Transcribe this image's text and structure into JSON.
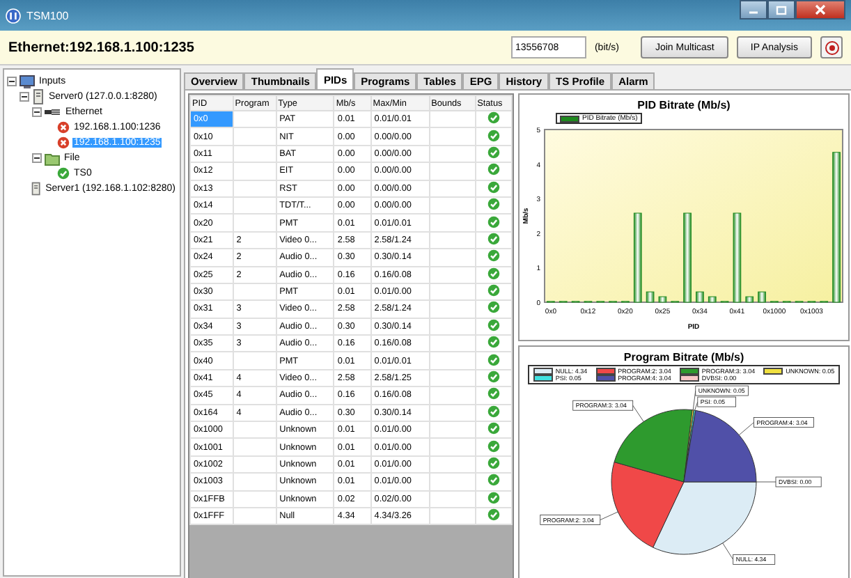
{
  "window": {
    "title": "TSM100"
  },
  "header": {
    "source": "Ethernet:192.168.1.100:1235",
    "bitrate_value": "13556708",
    "bitrate_unit": "(bit/s)",
    "buttons": [
      "Join Multicast",
      "IP Analysis"
    ]
  },
  "tree": [
    {
      "label": "Inputs",
      "kind": "root",
      "expanded": true,
      "selected": false,
      "children": [
        {
          "label": "Server0 (127.0.0.1:8280)",
          "kind": "server",
          "expanded": true,
          "selected": false,
          "children": [
            {
              "label": "Ethernet",
              "kind": "network",
              "expanded": true,
              "selected": false,
              "children": [
                {
                  "label": "192.168.1.100:1236",
                  "kind": "error",
                  "selected": false
                },
                {
                  "label": "192.168.1.100:1235",
                  "kind": "error",
                  "selected": true
                }
              ]
            },
            {
              "label": "File",
              "kind": "file",
              "expanded": true,
              "selected": false,
              "children": [
                {
                  "label": "TS0",
                  "kind": "ok",
                  "selected": false
                }
              ]
            }
          ]
        },
        {
          "label": "Server1 (192.168.1.102:8280)",
          "kind": "server",
          "selected": false
        }
      ]
    }
  ],
  "tabs": [
    {
      "label": "Overview",
      "selected": false
    },
    {
      "label": "Thumbnails",
      "selected": false
    },
    {
      "label": "PIDs",
      "selected": true
    },
    {
      "label": "Programs",
      "selected": false
    },
    {
      "label": "Tables",
      "selected": false
    },
    {
      "label": "EPG",
      "selected": false
    },
    {
      "label": "History",
      "selected": false
    },
    {
      "label": "TS Profile",
      "selected": false
    },
    {
      "label": "Alarm",
      "selected": false
    }
  ],
  "table": {
    "columns": [
      "PID",
      "Program",
      "Type",
      "Mb/s",
      "Max/Min",
      "Bounds",
      "Status"
    ],
    "rows": [
      {
        "pid": "0x0",
        "type": "PAT",
        "rate": "0.01",
        "maxmin": "0.01/0.01",
        "ok": true,
        "selected": true
      },
      {
        "pid": "0x10",
        "type": "NIT",
        "rate": "0.00",
        "maxmin": "0.00/0.00",
        "ok": true,
        "selected": false
      },
      {
        "pid": "0x11",
        "type": "BAT",
        "rate": "0.00",
        "maxmin": "0.00/0.00",
        "ok": true,
        "selected": false
      },
      {
        "pid": "0x12",
        "type": "EIT",
        "rate": "0.00",
        "maxmin": "0.00/0.00",
        "ok": true,
        "selected": false
      },
      {
        "pid": "0x13",
        "type": "RST",
        "rate": "0.00",
        "maxmin": "0.00/0.00",
        "ok": true,
        "selected": false
      },
      {
        "pid": "0x14",
        "type": "TDT/T...",
        "rate": "0.00",
        "maxmin": "0.00/0.00",
        "ok": true,
        "selected": false
      },
      {
        "pid": "0x20",
        "type": "PMT",
        "rate": "0.01",
        "maxmin": "0.01/0.01",
        "ok": true,
        "selected": false
      },
      {
        "pid": "0x21",
        "program": "2",
        "type": "Video 0...",
        "rate": "2.58",
        "maxmin": "2.58/1.24",
        "ok": true,
        "selected": false
      },
      {
        "pid": "0x24",
        "program": "2",
        "type": "Audio 0...",
        "rate": "0.30",
        "maxmin": "0.30/0.14",
        "ok": true,
        "selected": false
      },
      {
        "pid": "0x25",
        "program": "2",
        "type": "Audio 0...",
        "rate": "0.16",
        "maxmin": "0.16/0.08",
        "ok": true,
        "selected": false
      },
      {
        "pid": "0x30",
        "type": "PMT",
        "rate": "0.01",
        "maxmin": "0.01/0.00",
        "ok": true,
        "selected": false
      },
      {
        "pid": "0x31",
        "program": "3",
        "type": "Video 0...",
        "rate": "2.58",
        "maxmin": "2.58/1.24",
        "ok": true,
        "selected": false
      },
      {
        "pid": "0x34",
        "program": "3",
        "type": "Audio 0...",
        "rate": "0.30",
        "maxmin": "0.30/0.14",
        "ok": true,
        "selected": false
      },
      {
        "pid": "0x35",
        "program": "3",
        "type": "Audio 0...",
        "rate": "0.16",
        "maxmin": "0.16/0.08",
        "ok": true,
        "selected": false
      },
      {
        "pid": "0x40",
        "type": "PMT",
        "rate": "0.01",
        "maxmin": "0.01/0.01",
        "ok": true,
        "selected": false
      },
      {
        "pid": "0x41",
        "program": "4",
        "type": "Video 0...",
        "rate": "2.58",
        "maxmin": "2.58/1.25",
        "ok": true,
        "selected": false
      },
      {
        "pid": "0x45",
        "program": "4",
        "type": "Audio 0...",
        "rate": "0.16",
        "maxmin": "0.16/0.08",
        "ok": true,
        "selected": false
      },
      {
        "pid": "0x164",
        "program": "4",
        "type": "Audio 0...",
        "rate": "0.30",
        "maxmin": "0.30/0.14",
        "ok": true,
        "selected": false
      },
      {
        "pid": "0x1000",
        "type": "Unknown",
        "rate": "0.01",
        "maxmin": "0.01/0.00",
        "ok": true,
        "selected": false
      },
      {
        "pid": "0x1001",
        "type": "Unknown",
        "rate": "0.01",
        "maxmin": "0.01/0.00",
        "ok": true,
        "selected": false
      },
      {
        "pid": "0x1002",
        "type": "Unknown",
        "rate": "0.01",
        "maxmin": "0.01/0.00",
        "ok": true,
        "selected": false
      },
      {
        "pid": "0x1003",
        "type": "Unknown",
        "rate": "0.01",
        "maxmin": "0.01/0.00",
        "ok": true,
        "selected": false
      },
      {
        "pid": "0x1FFB",
        "type": "Unknown",
        "rate": "0.02",
        "maxmin": "0.02/0.00",
        "ok": true,
        "selected": false
      },
      {
        "pid": "0x1FFF",
        "type": "Null",
        "rate": "4.34",
        "maxmin": "4.34/3.26",
        "ok": true,
        "selected": false
      }
    ]
  },
  "bar_panel": {
    "chart_data": {
      "type": "bar",
      "title": "PID Bitrate (Mb/s)",
      "xlabel": "PID",
      "ylabel": "Mb/s",
      "categories": [
        "0x0",
        null,
        null,
        "0x12",
        null,
        null,
        "0x20",
        null,
        null,
        "0x25",
        null,
        null,
        "0x34",
        null,
        null,
        "0x41",
        null,
        null,
        "0x1000",
        null,
        null,
        "0x1003",
        null,
        null
      ],
      "series": [
        {
          "name": "PID Bitrate (Mb/s)",
          "color": "#1e8a1e",
          "values": [
            0.01,
            0,
            0,
            0,
            0,
            0,
            0.01,
            2.58,
            0.3,
            0.16,
            0.01,
            2.58,
            0.3,
            0.16,
            0.01,
            2.58,
            0.16,
            0.3,
            0.01,
            0.01,
            0.01,
            0.01,
            0.02,
            4.34
          ]
        }
      ],
      "ylim": [
        0,
        5
      ],
      "yticks": [
        0,
        1,
        2,
        3,
        4,
        5
      ]
    }
  },
  "pie_panel": {
    "legend": [
      {
        "label": "NULL: 4.34",
        "color": "#dcecf5"
      },
      {
        "label": "PROGRAM:2: 3.04",
        "color": "#f04848"
      },
      {
        "label": "PROGRAM:3: 3.04",
        "color": "#2e9a2e"
      },
      {
        "label": "UNKNOWN: 0.05",
        "color": "#f0e040"
      },
      {
        "label": "PSI: 0.05",
        "color": "#40e0e0"
      },
      {
        "label": "PROGRAM:4: 3.04",
        "color": "#5050a8"
      },
      {
        "label": "DVBSI: 0.00",
        "color": "#f8c8c8"
      }
    ],
    "chart_data": {
      "type": "pie",
      "title": "Program Bitrate (Mb/s)",
      "categories": [
        "NULL: 4.34",
        "PROGRAM:2: 3.04",
        "PROGRAM:3: 3.04",
        "UNKNOWN: 0.05",
        "PSI: 0.05",
        "PROGRAM:4: 3.04",
        "DVBSI: 0.00"
      ],
      "series": [
        {
          "values": [
            4.34,
            3.04,
            3.04,
            0.05,
            0.05,
            3.04,
            0
          ]
        }
      ]
    }
  }
}
